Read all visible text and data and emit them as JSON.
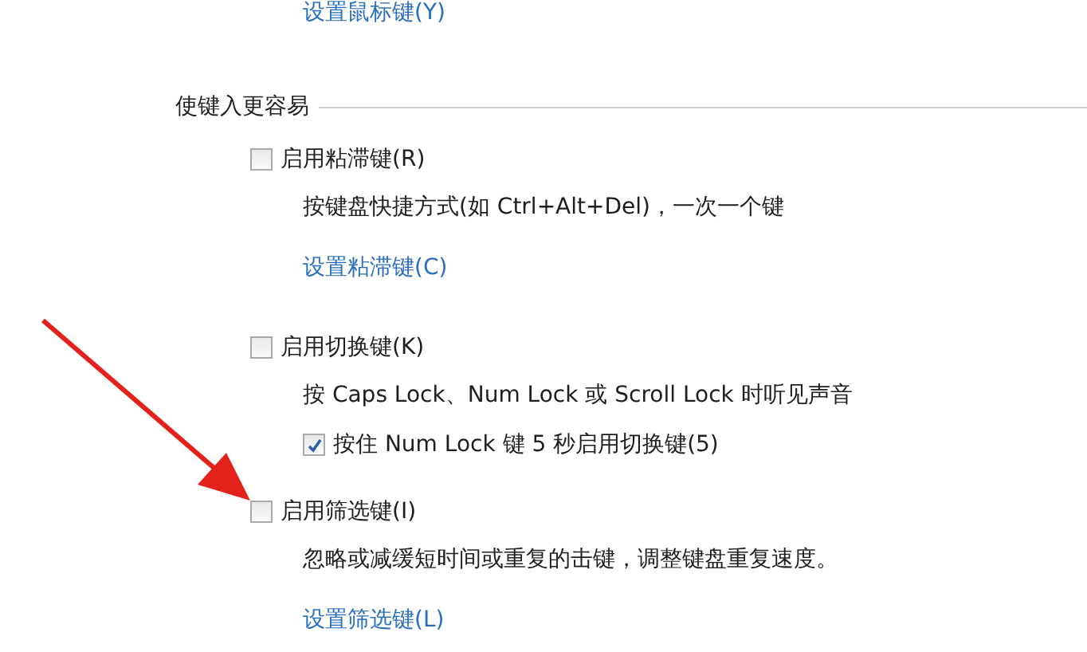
{
  "top_link": "设置鼠标键(Y)",
  "section": {
    "title": "使键入更容易",
    "items": [
      {
        "kind": "check",
        "label": "启用粘滞键(R)",
        "checked": false
      },
      {
        "kind": "text",
        "text": "按键盘快捷方式(如 Ctrl+Alt+Del)，一次一个键"
      },
      {
        "kind": "link",
        "text": "设置粘滞键(C)"
      },
      {
        "kind": "check",
        "label": "启用切换键(K)",
        "checked": false
      },
      {
        "kind": "text",
        "text": "按 Caps Lock、Num Lock 或 Scroll Lock 时听见声音"
      },
      {
        "kind": "subcheck",
        "label": "按住 Num Lock 键 5 秒启用切换键(5)",
        "checked": true
      },
      {
        "kind": "check",
        "label": "启用筛选键(I)",
        "checked": false
      },
      {
        "kind": "text",
        "text": "忽略或减缓短时间或重复的击键，调整键盘重复速度。"
      },
      {
        "kind": "link",
        "text": "设置筛选键(L)"
      }
    ]
  }
}
